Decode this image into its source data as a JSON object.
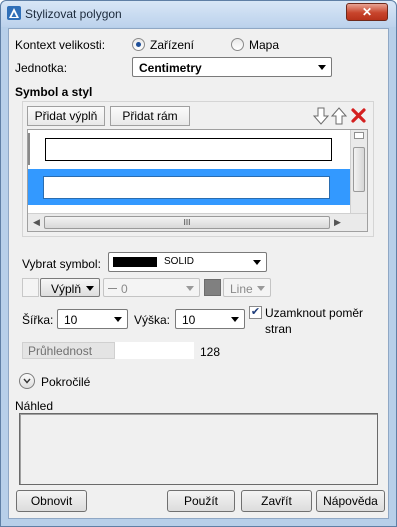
{
  "window": {
    "title": "Stylizovat polygon",
    "close_glyph": "✕"
  },
  "size_context": {
    "label": "Kontext velikosti:",
    "option_device": "Zařízení",
    "option_map": "Mapa",
    "selected": "Zařízení"
  },
  "unit": {
    "label": "Jednotka:",
    "value": "Centimetry"
  },
  "symbol_style": {
    "heading": "Symbol a styl",
    "add_fill_label": "Přidat výplň",
    "add_border_label": "Přidat rám",
    "selected_row_color": "#3399ff"
  },
  "select_symbol": {
    "label": "Vybrat symbol:",
    "value": "SOLID"
  },
  "fill_row": {
    "fill_label": "Výplň",
    "line_value": "0",
    "line_type": "Line"
  },
  "width": {
    "label": "Šířka:",
    "value": "10"
  },
  "height": {
    "label": "Výška:",
    "value": "10"
  },
  "lock_ratio": {
    "label_line1": "Uzamknout poměr",
    "label_line2": "stran",
    "checked": true,
    "check_glyph": "✔"
  },
  "transparency": {
    "label": "Průhlednost",
    "value": "128"
  },
  "advanced": {
    "label": "Pokročilé"
  },
  "preview": {
    "label": "Náhled"
  },
  "scroll": {
    "thumb_glyph": "III"
  },
  "footer": {
    "reset_label": "Obnovit",
    "apply_label": "Použít",
    "close_label": "Zavřít",
    "help_label": "Nápověda"
  },
  "icons": {
    "app": "app-icon",
    "down": "arrow-down-icon",
    "up": "arrow-up-icon",
    "delete": "delete-icon",
    "chevron": "chevron-down-icon"
  }
}
